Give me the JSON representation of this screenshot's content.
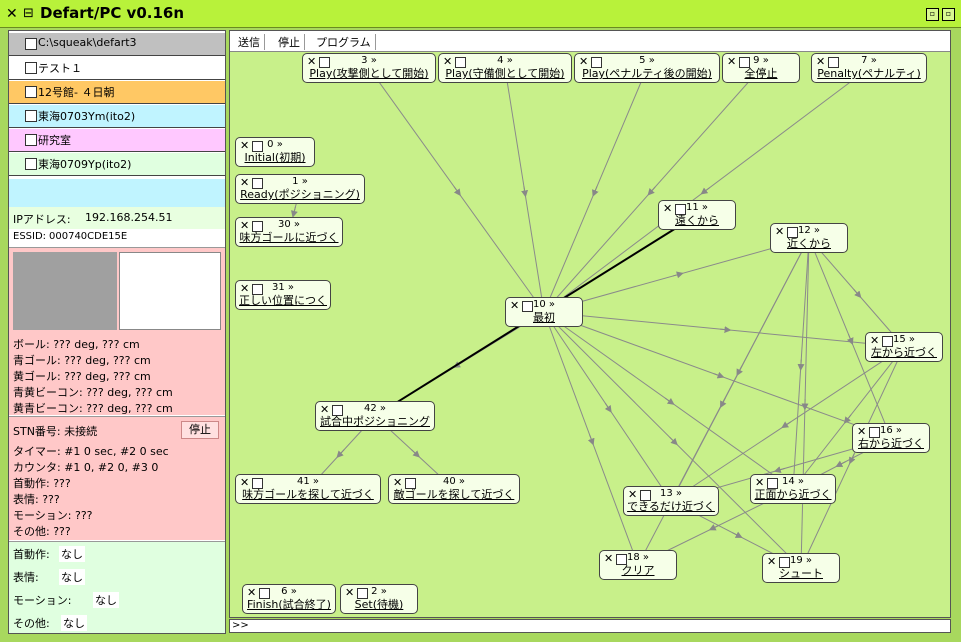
{
  "window": {
    "title": "Defart/PC v0.16n",
    "close_glyph": "✕",
    "menu_glyph": "⊟",
    "btn1_glyph": "▫",
    "btn2_glyph": "▫"
  },
  "directories": [
    {
      "label": "C:\\squeak\\defart3",
      "color": "#c0c0c0"
    },
    {
      "label": "テスト１",
      "color": "#ffffff"
    },
    {
      "label": "12号館- ４日朝",
      "color": "#ffc864"
    },
    {
      "label": "東海0703Ym(ito2)",
      "color": "#c0f4ff"
    },
    {
      "label": "研究室",
      "color": "#ffc8ff"
    },
    {
      "label": "東海0709Yp(ito2)",
      "color": "#e0ffe0"
    }
  ],
  "network": {
    "ip_label": "IPアドレス:",
    "ip_value": "192.168.254.51",
    "essid_label": "ESSID:",
    "essid_value": "000740CDE15E"
  },
  "vision": {
    "ball": "ボール: ??? deg, ??? cm",
    "blue_goal": "青ゴール: ??? deg, ??? cm",
    "yellow_goal": "黄ゴール: ??? deg, ??? cm",
    "blue_yellow_beacon": "青黄ビーコン: ??? deg, ??? cm",
    "yellow_blue_beacon": "黄青ビーコン: ??? deg, ??? cm"
  },
  "status": {
    "stn": "STN番号: 未接続",
    "stop_label": "停止",
    "timer": "タイマー: #1 0 sec, #2 0 sec",
    "counter": "カウンタ: #1 0, #2 0, #3 0",
    "head_motion": "首動作: ???",
    "expression": "表情: ???",
    "motion": "モーション: ???",
    "other": "その他: ???"
  },
  "manual": [
    {
      "label": "首動作:",
      "value": "なし"
    },
    {
      "label": "表情:",
      "value": "なし"
    },
    {
      "label": "モーション:",
      "value": "なし"
    },
    {
      "label": "その他:",
      "value": "なし"
    }
  ],
  "menu": [
    "送信",
    "停止",
    "プログラム"
  ],
  "states": [
    {
      "id": "3",
      "label": "Play(攻撃側として開始)"
    },
    {
      "id": "4",
      "label": "Play(守備側として開始)"
    },
    {
      "id": "5",
      "label": "Play(ペナルティ後の開始)"
    },
    {
      "id": "9",
      "label": "全停止"
    },
    {
      "id": "7",
      "label": "Penalty(ペナルティ)"
    },
    {
      "id": "0",
      "label": "Initial(初期)"
    },
    {
      "id": "1",
      "label": "Ready(ポジショニング)"
    },
    {
      "id": "30",
      "label": "味方ゴールに近づく"
    },
    {
      "id": "31",
      "label": "正しい位置につく"
    },
    {
      "id": "11",
      "label": "遠くから"
    },
    {
      "id": "12",
      "label": "近くから"
    },
    {
      "id": "10",
      "label": "最初"
    },
    {
      "id": "15",
      "label": "左から近づく"
    },
    {
      "id": "42",
      "label": "試合中ポジショニング"
    },
    {
      "id": "16",
      "label": "右から近づく"
    },
    {
      "id": "41",
      "label": "味方ゴールを探して近づく"
    },
    {
      "id": "40",
      "label": "敵ゴールを探して近づく"
    },
    {
      "id": "13",
      "label": "できるだけ近づく"
    },
    {
      "id": "14",
      "label": "正面から近づく"
    },
    {
      "id": "18",
      "label": "クリア"
    },
    {
      "id": "19",
      "label": "シュート"
    },
    {
      "id": "6",
      "label": "Finish(試合終了)"
    },
    {
      "id": "2",
      "label": "Set(待機)"
    }
  ],
  "node_marks": {
    "close": "✕",
    "arrows": "»"
  },
  "command_prompt": ">>"
}
